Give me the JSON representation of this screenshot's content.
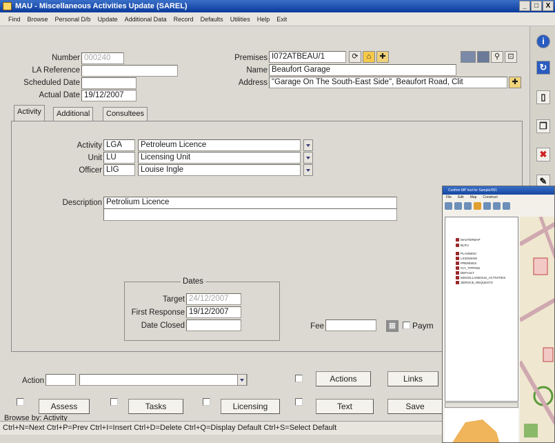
{
  "window": {
    "title": "MAU - Miscellaneous Activities Update  (SAREL)",
    "controls": [
      "_",
      "□",
      "X"
    ]
  },
  "menu": [
    "Find",
    "Browse",
    "Personal D/b",
    "Update",
    "Additional Data",
    "Record",
    "Defaults",
    "Utilities",
    "Help",
    "Exit"
  ],
  "form": {
    "number_label": "Number",
    "number_value": "000240",
    "la_reference_label": "LA Reference",
    "la_reference_value": "",
    "scheduled_date_label": "Scheduled Date",
    "scheduled_date_value": "",
    "actual_date_label": "Actual Date",
    "actual_date_value": "19/12/2007",
    "premises_label": "Premises",
    "premises_value": "I072ATBEAU/1",
    "name_label": "Name",
    "name_value": "Beaufort Garage",
    "address_label": "Address",
    "address_value": "\"Garage On The South-East Side\", Beaufort Road, Clit"
  },
  "tabs": [
    "Activity",
    "Additional",
    "Consultees"
  ],
  "activity": {
    "activity_label": "Activity",
    "activity_code": "LGA",
    "activity_desc": "Petroleum Licence",
    "unit_label": "Unit",
    "unit_code": "LU",
    "unit_desc": "Licensing Unit",
    "officer_label": "Officer",
    "officer_code": "LIG",
    "officer_desc": "Louise Ingle",
    "description_label": "Description",
    "description_line1": "Petrolium Licence",
    "description_line2": ""
  },
  "dates": {
    "heading": "Dates",
    "target_label": "Target",
    "target_value": "24/12/2007",
    "first_response_label": "First Response",
    "first_response_value": "19/12/2007",
    "date_closed_label": "Date Closed",
    "date_closed_value": ""
  },
  "fee": {
    "label": "Fee",
    "value": "",
    "payment_label": "Paym"
  },
  "bottom": {
    "action_label": "Action",
    "action_code": "",
    "action_desc": "",
    "actions_button": "Actions",
    "links_button": "Links",
    "assess_button": "Assess",
    "tasks_button": "Tasks",
    "licensing_button": "Licensing",
    "text_button": "Text",
    "save_button": "Save"
  },
  "status": {
    "browse_by": "Browse by: Activity",
    "shortcuts": "Ctrl+N=Next  Ctrl+P=Prev  Ctrl+I=Insert  Ctrl+D=Delete  Ctrl+Q=Display Default  Ctrl+S=Select Default"
  },
  "map_window": {
    "title": "Confirm MP tool for Sample/001",
    "menu": [
      "File",
      "Edit",
      "Map",
      "Construct"
    ],
    "layers": [
      "MASTERMAP",
      "BLPU",
      "PLANNING",
      "LICENSING",
      "PREMISES",
      "FLY_TIPPING",
      "DEFAULT",
      "MISCELLANEOUS_ACTIVITIES",
      "SERVICE_REQUESTS"
    ]
  },
  "icons": {
    "right_toolbar": [
      "info-icon",
      "refresh-icon",
      "new-record-icon",
      "copy-icon",
      "delete-icon",
      "edit-icon"
    ]
  },
  "colors": {
    "title_bar": "#0a3a9c",
    "form_bg": "#dcd9d2",
    "field_bg": "#ffffff"
  }
}
